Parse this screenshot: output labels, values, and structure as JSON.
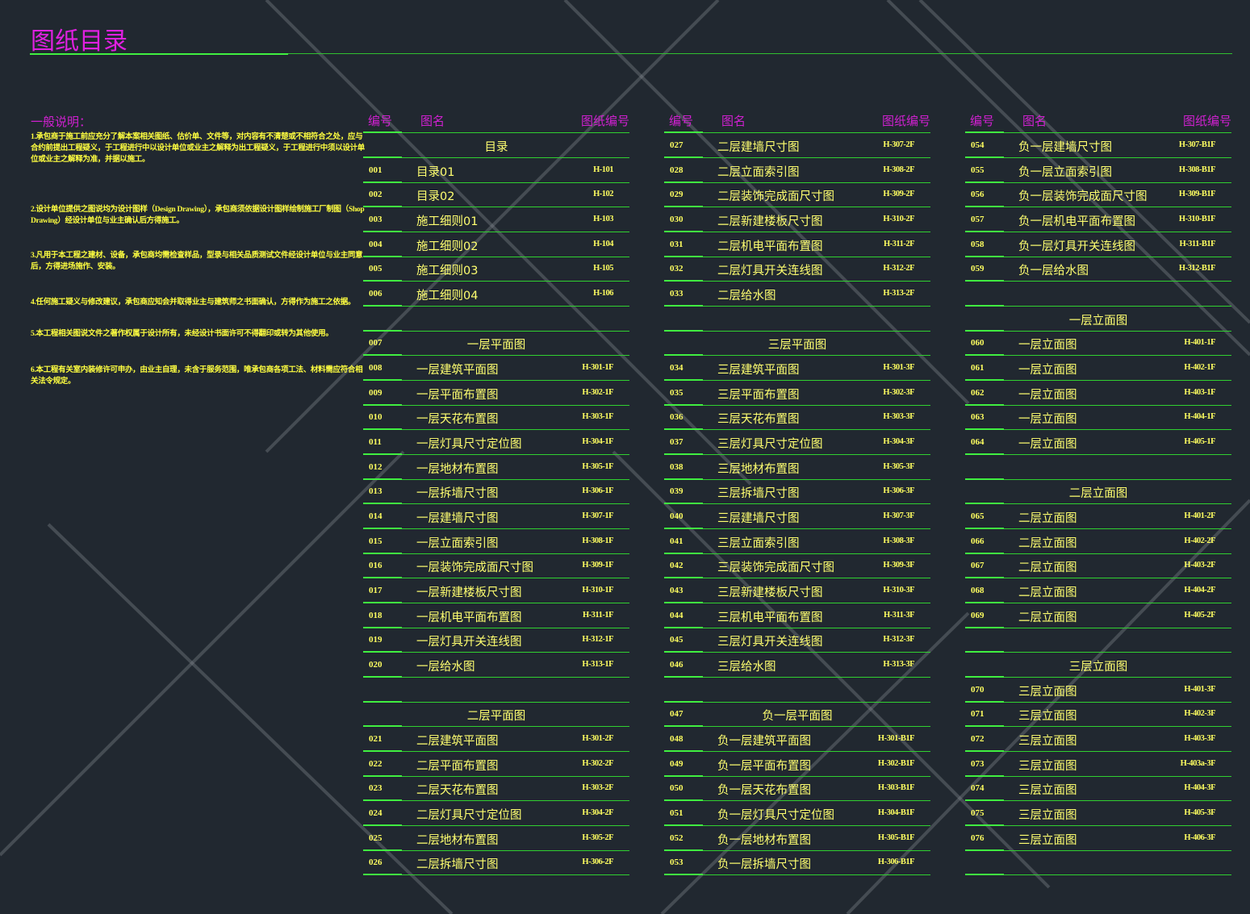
{
  "title": "图纸目录",
  "notes": {
    "heading": "一般说明：",
    "items": [
      "1.承包商于施工前应充分了解本案相关图纸、估价单、文件等，对内容有不清楚或不相符合之处，应与合约前提出工程疑义，于工程进行中以设计单位或业主之解释为出工程疑义，于工程进行中须以设计单位或业主之解释为准，并据以施工。",
      "2.设计单位提供之图说均为设计图样（Design Drawing），承包商须依据设计图样绘制施工厂制图（Shop Drawing）经设计单位与业主确认后方得施工。",
      "3.凡用于本工程之建材、设备，承包商均需检查样品，型录与相关品质测试文件经设计单位与业主同意后，方得进场施作、安装。",
      "4.任何施工疑义与修改建议，承包商应知会并取得业主与建筑师之书面确认，方得作为施工之依据。",
      "5.本工程相关图说文件之著作权属于设计所有，未经设计书面许可不得翻印或转为其他使用。",
      "6.本工程有关室内装修许可申办，由业主自理，未含于服务范围，唯承包商各项工法、材料需应符合相关法令规定。"
    ]
  },
  "headers": {
    "num": "编号",
    "name": "图名",
    "code": "图纸编号"
  },
  "columns": [
    [
      {
        "section": "目录"
      },
      {
        "num": "001",
        "name": "目录01",
        "code": "H-101"
      },
      {
        "num": "002",
        "name": "目录02",
        "code": "H-102"
      },
      {
        "num": "003",
        "name": "施工细则01",
        "code": "H-103"
      },
      {
        "num": "004",
        "name": "施工细则02",
        "code": "H-104"
      },
      {
        "num": "005",
        "name": "施工细则03",
        "code": "H-105"
      },
      {
        "num": "006",
        "name": "施工细则04",
        "code": "H-106"
      },
      {},
      {
        "num": "007",
        "section": "一层平面图"
      },
      {
        "num": "008",
        "name": "一层建筑平面图",
        "code": "H-301-1F"
      },
      {
        "num": "009",
        "name": "一层平面布置图",
        "code": "H-302-1F"
      },
      {
        "num": "010",
        "name": "一层天花布置图",
        "code": "H-303-1F"
      },
      {
        "num": "011",
        "name": "一层灯具尺寸定位图",
        "code": "H-304-1F"
      },
      {
        "num": "012",
        "name": "一层地材布置图",
        "code": "H-305-1F"
      },
      {
        "num": "013",
        "name": "一层拆墙尺寸图",
        "code": "H-306-1F"
      },
      {
        "num": "014",
        "name": "一层建墙尺寸图",
        "code": "H-307-1F"
      },
      {
        "num": "015",
        "name": "一层立面索引图",
        "code": "H-308-1F"
      },
      {
        "num": "016",
        "name": "一层装饰完成面尺寸图",
        "code": "H-309-1F"
      },
      {
        "num": "017",
        "name": "一层新建楼板尺寸图",
        "code": "H-310-1F"
      },
      {
        "num": "018",
        "name": "一层机电平面布置图",
        "code": "H-311-1F"
      },
      {
        "num": "019",
        "name": "一层灯具开关连线图",
        "code": "H-312-1F"
      },
      {
        "num": "020",
        "name": "一层给水图",
        "code": "H-313-1F"
      },
      {},
      {
        "section": "二层平面图"
      },
      {
        "num": "021",
        "name": "二层建筑平面图",
        "code": "H-301-2F"
      },
      {
        "num": "022",
        "name": "二层平面布置图",
        "code": "H-302-2F"
      },
      {
        "num": "023",
        "name": "二层天花布置图",
        "code": "H-303-2F"
      },
      {
        "num": "024",
        "name": "二层灯具尺寸定位图",
        "code": "H-304-2F"
      },
      {
        "num": "025",
        "name": "二层地材布置图",
        "code": "H-305-2F"
      },
      {
        "num": "026",
        "name": "二层拆墙尺寸图",
        "code": "H-306-2F"
      }
    ],
    [
      {
        "num": "027",
        "name": "二层建墙尺寸图",
        "code": "H-307-2F"
      },
      {
        "num": "028",
        "name": "二层立面索引图",
        "code": "H-308-2F"
      },
      {
        "num": "029",
        "name": "二层装饰完成面尺寸图",
        "code": "H-309-2F"
      },
      {
        "num": "030",
        "name": "二层新建楼板尺寸图",
        "code": "H-310-2F"
      },
      {
        "num": "031",
        "name": "二层机电平面布置图",
        "code": "H-311-2F"
      },
      {
        "num": "032",
        "name": "二层灯具开关连线图",
        "code": "H-312-2F"
      },
      {
        "num": "033",
        "name": "二层给水图",
        "code": "H-313-2F"
      },
      {},
      {
        "section": "三层平面图"
      },
      {
        "num": "034",
        "name": "三层建筑平面图",
        "code": "H-301-3F"
      },
      {
        "num": "035",
        "name": "三层平面布置图",
        "code": "H-302-3F"
      },
      {
        "num": "036",
        "name": "三层天花布置图",
        "code": "H-303-3F"
      },
      {
        "num": "037",
        "name": "三层灯具尺寸定位图",
        "code": "H-304-3F"
      },
      {
        "num": "038",
        "name": "三层地材布置图",
        "code": "H-305-3F"
      },
      {
        "num": "039",
        "name": "三层拆墙尺寸图",
        "code": "H-306-3F"
      },
      {
        "num": "040",
        "name": "三层建墙尺寸图",
        "code": "H-307-3F"
      },
      {
        "num": "041",
        "name": "三层立面索引图",
        "code": "H-308-3F"
      },
      {
        "num": "042",
        "name": "三层装饰完成面尺寸图",
        "code": "H-309-3F"
      },
      {
        "num": "043",
        "name": "三层新建楼板尺寸图",
        "code": "H-310-3F"
      },
      {
        "num": "044",
        "name": "三层机电平面布置图",
        "code": "H-311-3F"
      },
      {
        "num": "045",
        "name": "三层灯具开关连线图",
        "code": "H-312-3F"
      },
      {
        "num": "046",
        "name": "三层给水图",
        "code": "H-313-3F"
      },
      {},
      {
        "num": "047",
        "section": "负一层平面图"
      },
      {
        "num": "048",
        "name": "负一层建筑平面图",
        "code": "H-301-B1F"
      },
      {
        "num": "049",
        "name": "负一层平面布置图",
        "code": "H-302-B1F"
      },
      {
        "num": "050",
        "name": "负一层天花布置图",
        "code": "H-303-B1F"
      },
      {
        "num": "051",
        "name": "负一层灯具尺寸定位图",
        "code": "H-304-B1F"
      },
      {
        "num": "052",
        "name": "负一层地材布置图",
        "code": "H-305-B1F"
      },
      {
        "num": "053",
        "name": "负一层拆墙尺寸图",
        "code": "H-306-B1F"
      }
    ],
    [
      {
        "num": "054",
        "name": "负一层建墙尺寸图",
        "code": "H-307-B1F"
      },
      {
        "num": "055",
        "name": "负一层立面索引图",
        "code": "H-308-B1F"
      },
      {
        "num": "056",
        "name": "负一层装饰完成面尺寸图",
        "code": "H-309-B1F"
      },
      {
        "num": "057",
        "name": "负一层机电平面布置图",
        "code": "H-310-B1F"
      },
      {
        "num": "058",
        "name": "负一层灯具开关连线图",
        "code": "H-311-B1F"
      },
      {
        "num": "059",
        "name": "负一层给水图",
        "code": "H-312-B1F"
      },
      {},
      {
        "section": "一层立面图"
      },
      {
        "num": "060",
        "name": "一层立面图",
        "code": "H-401-1F"
      },
      {
        "num": "061",
        "name": "一层立面图",
        "code": "H-402-1F"
      },
      {
        "num": "062",
        "name": "一层立面图",
        "code": "H-403-1F"
      },
      {
        "num": "063",
        "name": "一层立面图",
        "code": "H-404-1F"
      },
      {
        "num": "064",
        "name": "一层立面图",
        "code": "H-405-1F"
      },
      {},
      {
        "section": "二层立面图"
      },
      {
        "num": "065",
        "name": "二层立面图",
        "code": "H-401-2F"
      },
      {
        "num": "066",
        "name": "二层立面图",
        "code": "H-402-2F"
      },
      {
        "num": "067",
        "name": "二层立面图",
        "code": "H-403-2F"
      },
      {
        "num": "068",
        "name": "二层立面图",
        "code": "H-404-2F"
      },
      {
        "num": "069",
        "name": "二层立面图",
        "code": "H-405-2F"
      },
      {},
      {
        "section": "三层立面图"
      },
      {
        "num": "070",
        "name": "三层立面图",
        "code": "H-401-3F"
      },
      {
        "num": "071",
        "name": "三层立面图",
        "code": "H-402-3F"
      },
      {
        "num": "072",
        "name": "三层立面图",
        "code": "H-403-3F"
      },
      {
        "num": "073",
        "name": "三层立面图",
        "code": "H-403a-3F"
      },
      {
        "num": "074",
        "name": "三层立面图",
        "code": "H-404-3F"
      },
      {
        "num": "075",
        "name": "三层立面图",
        "code": "H-405-3F"
      },
      {
        "num": "076",
        "name": "三层立面图",
        "code": "H-406-3F"
      },
      {}
    ]
  ]
}
